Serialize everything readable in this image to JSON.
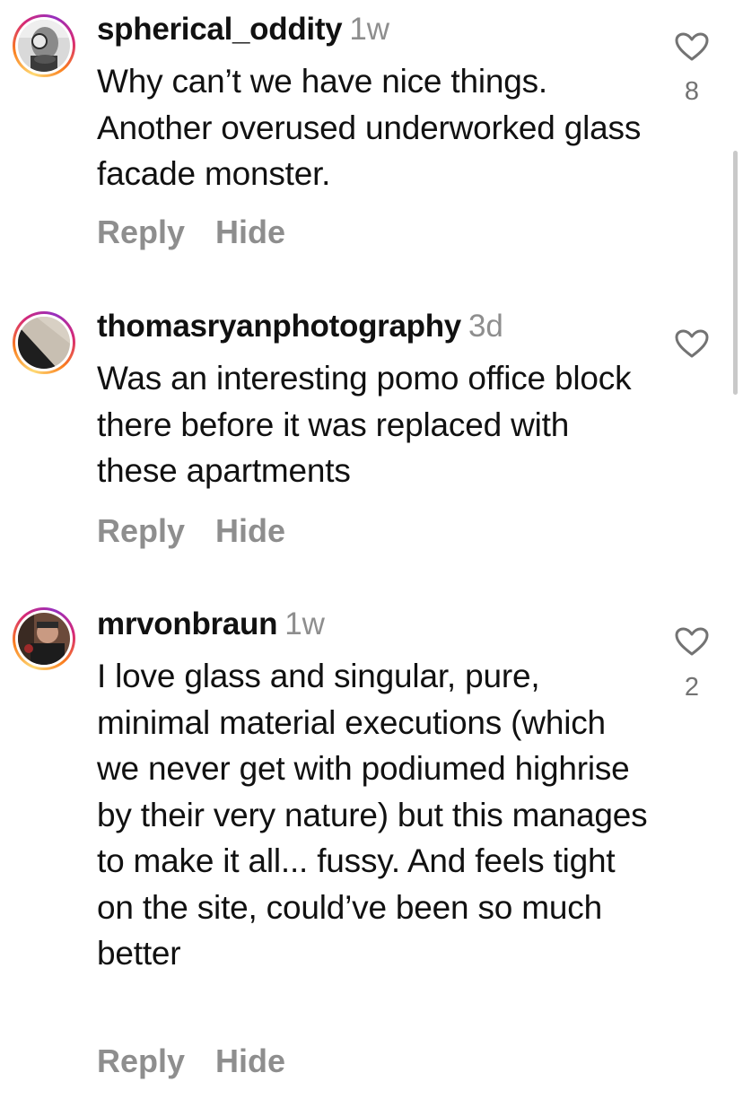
{
  "comments": [
    {
      "username": "spherical_oddity",
      "time": "1w",
      "text": "Why can’t we have nice things. Another overused underworked glass facade monster.",
      "reply_label": "Reply",
      "hide_label": "Hide",
      "like_icon": "heart-outline-icon",
      "like_count": "8"
    },
    {
      "username": "thomasryanphotography",
      "time": "3d",
      "text": "Was an interesting pomo office block there before it was replaced with these apartments",
      "reply_label": "Reply",
      "hide_label": "Hide",
      "like_icon": "heart-outline-icon",
      "like_count": ""
    },
    {
      "username": "mrvonbraun",
      "time": "1w",
      "text": "I love glass and singular, pure, minimal material executions (which we never get with podiumed highrise by their very nature) but this manages to make it all... fussy. And feels tight on the site, could’ve been so much better",
      "reply_label": "Reply",
      "hide_label": "Hide",
      "like_icon": "heart-outline-icon",
      "like_count": "2"
    }
  ],
  "colors": {
    "text_primary": "#111111",
    "text_secondary": "#8e8e8e",
    "story_ring": [
      "#feda75",
      "#fa7e1e",
      "#d62976",
      "#962fbf"
    ]
  }
}
